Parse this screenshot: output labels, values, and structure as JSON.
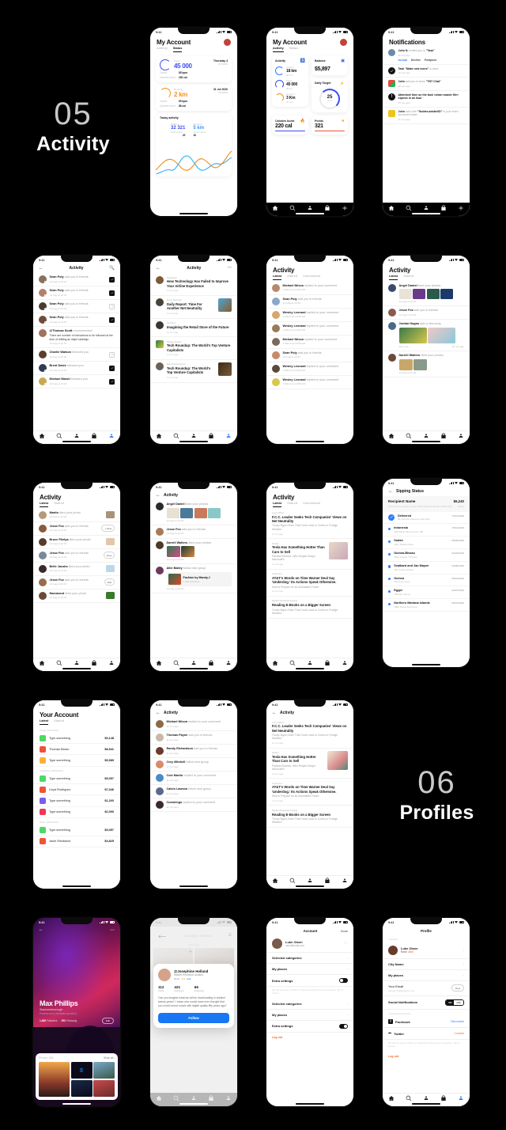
{
  "canvas": {
    "background": "#000000"
  },
  "sections": [
    {
      "number": "05",
      "title": "Activity"
    },
    {
      "number": "06",
      "title": "Profiles"
    }
  ],
  "status_bar": {
    "time": "9:41"
  },
  "colors": {
    "accent_blue": "#2f7bff",
    "indigo": "#3d4ef0",
    "orange": "#f59219",
    "logout_orange": "#f06a1e",
    "facebook_blue": "#1877f2",
    "green_dot": "#35c759"
  },
  "tabbar": {
    "items": [
      "home-icon",
      "search-icon",
      "people-icon",
      "bag-icon",
      "profile-icon"
    ]
  },
  "screens": {
    "my_account_status": {
      "title": "My Account",
      "tabs": [
        {
          "label": "Activity",
          "active": false
        },
        {
          "label": "Status",
          "active": true
        }
      ],
      "cards": [
        {
          "metric_label": "Steps",
          "metric_value": "45 000",
          "date": "Thursday 4",
          "time": "05:50PM",
          "rows": [
            {
              "k": "Cardio",
              "v": "85 bpm"
            },
            {
              "k": "Calories burnt",
              "v": "230 cal"
            }
          ]
        },
        {
          "metric_label": "Running",
          "metric_value": "2 km",
          "date": "31 Jul 2020",
          "time": "05:50PM",
          "rows": [
            {
              "k": "Cardio",
              "v": "65 bpm"
            },
            {
              "k": "Calories burnt",
              "v": "88 cal"
            }
          ]
        }
      ],
      "today": {
        "title": "Today activity",
        "left": {
          "label": "Walking",
          "value": "32 321",
          "sub": "1h30 active",
          "extra": "20"
        },
        "right": {
          "label": "Running",
          "value": "5 km",
          "sub": "30 min active",
          "extra": "16"
        }
      }
    },
    "my_account_activity": {
      "title": "My Account",
      "tabs": [
        {
          "label": "Activity",
          "active": true
        },
        {
          "label": "Status",
          "active": false
        }
      ],
      "activity_card_title": "Activity",
      "activities": [
        {
          "label": "Cycling",
          "value": "18 km",
          "sub": "68 min"
        },
        {
          "label": "Steps",
          "value": "45 000",
          "sub": "05 km"
        },
        {
          "label": "Running",
          "value": "3 Km",
          "sub": "32 min"
        }
      ],
      "balance": {
        "title": "Balance",
        "value": "$5,897"
      },
      "daily_target": {
        "title": "Daily Target",
        "value": "25",
        "unit": "of 40"
      },
      "calories": {
        "title": "Calories burnt",
        "value": "220 cal"
      },
      "points": {
        "title": "Points",
        "value": "321"
      }
    },
    "notifications": {
      "title": "Notifications",
      "items": [
        {
          "icon": "avatar",
          "bold": "John N.",
          "text": " invited you in ",
          "quoted": "\"Task\"",
          "time": "11 min ago",
          "actions": [
            "Accept",
            "Decline",
            "Postpone"
          ]
        },
        {
          "icon": "check",
          "bold": "Task ",
          "text": "",
          "quoted": "\"Make new icons\"",
          "suffix": " is done",
          "time": "10 min ago"
        },
        {
          "icon": "grid",
          "bold": "John",
          "text": " add you in team ",
          "quoted": "\"TNT Chat\"",
          "time": "08 min ago"
        },
        {
          "icon": "alert",
          "bold": "Attention!",
          "text": " time on the task «clean master file» expires in an hour",
          "time": "05 min ago"
        },
        {
          "icon": "file",
          "bold": "John",
          "text": " add a file ",
          "quoted": "\"Guides.adobeXD\"",
          "suffix": " in your team account's folder",
          "time": "11 min ago"
        }
      ]
    },
    "activity_friends": {
      "title": "Activity",
      "rows": [
        {
          "name": "Sean Poly",
          "action": " add you in friends",
          "time": "13 Aug at 10:12",
          "ctl": "check"
        },
        {
          "name": "Sean Poly",
          "action": " add you in friends",
          "time": "13 Aug at 12:33",
          "ctl": "check"
        },
        {
          "name": "Sean Poly",
          "action": " add you in friends",
          "time": "13 Aug at 12:33",
          "ctl": "plus"
        },
        {
          "name": "Sean Poly",
          "action": " add you in friends",
          "time": "13 Aug at 12:33",
          "ctl": "check"
        },
        {
          "name": "@Thomas Scott",
          "action": " recommended",
          "body": "There are number of instructions to be followed at the time of refilling an inkjet cartridge.",
          "time": "13 Aug at 12:33",
          "ctl": "none"
        },
        {
          "name": "Charlie Watson",
          "action": " followed you",
          "time": "13 Aug at 12:33",
          "ctl": "plus"
        },
        {
          "name": "Brent Davis",
          "action": " followed you",
          "time": "13 Aug at 12:33",
          "ctl": "check"
        },
        {
          "name": "Michael Marsh",
          "action": " followed you",
          "time": "13 Aug at 12:33",
          "ctl": "check"
        }
      ]
    },
    "news_list": {
      "title": "Activity",
      "items": [
        {
          "cat": "Firefighter",
          "title": "How Technology Has Failed to Improve Your Airline Experience",
          "time": "11 min ago",
          "img": false
        },
        {
          "cat": "Court Reporter",
          "title": "Daily Report: Time For Another Net Neutrality",
          "time": "11 min ago",
          "img": true
        },
        {
          "cat": "Architect",
          "title": "Imagining the Retail Store of the Future",
          "time": "11 min ago",
          "img": false
        },
        {
          "cat": "Mathematician",
          "title": "Tech Roundup: The World's Top Venture Capitalists",
          "time": "11 min ago",
          "img": false
        },
        {
          "cat": "Electrical Engineer",
          "title": "Tech Roundup: The World's Top Venture Capitalists",
          "time": "11 min ago",
          "img": true
        }
      ]
    },
    "activity_latest": {
      "title": "Activity",
      "tabs": [
        {
          "label": "Latest",
          "active": true
        },
        {
          "label": "Shared",
          "active": false
        },
        {
          "label": "Commented",
          "active": false
        }
      ],
      "rows": [
        {
          "name": "Michael Nilson",
          "action": " replied to your comment",
          "time": "4 March at 10:55 AM"
        },
        {
          "name": "Sean Poly",
          "action": " add you in friends",
          "time": "13 August 12:33"
        },
        {
          "name": "Wesley Leonard",
          "action": " replied to your comment",
          "time": "4 March at 10:55 AM"
        },
        {
          "name": "Wesley Leonard",
          "action": " replied to your comment",
          "time": "4 March at 10:55 AM"
        },
        {
          "name": "Michael Nilson",
          "action": " replied to your comment",
          "time": "4 March at 10:55 AM"
        },
        {
          "name": "Sean Poly",
          "action": " add you in friends",
          "time": "13 August 12:33"
        },
        {
          "name": "Wesley Leonard",
          "action": " replied to your comment",
          "time": "4 March at 10:55 AM"
        },
        {
          "name": "Wesley Leonard",
          "action": " replied to your comment",
          "time": "4 March at 10:55 AM"
        }
      ]
    },
    "activity_photos": {
      "title": "Activity",
      "tabs": [
        {
          "label": "Latest",
          "active": true
        },
        {
          "label": "Shared",
          "active": false
        }
      ],
      "rows": [
        {
          "name": "Angel Daniel",
          "action": " liked your photos",
          "time": "13 Aug at 12:33",
          "photos": 4
        },
        {
          "name": "Jesse Fox",
          "action": " add you in friends",
          "time": "13 Aug at 12:33",
          "photos": 0
        },
        {
          "name": "Jordan Hogan",
          "action": " add a new story",
          "photos": 2,
          "caption_left": "Just now",
          "caption_right": "45 min ago"
        },
        {
          "name": "Darrell Walters",
          "action": " liked your photos",
          "time": "13 Aug at 12:33",
          "photos": 2
        }
      ]
    },
    "activity_actions": {
      "title": "Activity",
      "tabs": [
        {
          "label": "Latest",
          "active": true
        },
        {
          "label": "Shared",
          "active": false
        }
      ],
      "rows": [
        {
          "name": "Martin",
          "action": " liked your photo",
          "time": "13 Aug at 12:33",
          "ctl": "thumb"
        },
        {
          "name": "Jesse Fox",
          "action": " add you in friends",
          "time": "13 Aug at 12:33",
          "ctl": "btn",
          "btn": "+ Now"
        },
        {
          "name": "Bruce Phelps",
          "action": " liked your photo",
          "time": "13 Aug at 12:33",
          "ctl": "thumb"
        },
        {
          "name": "Jesse Fox",
          "action": " add you in friends",
          "time": "13 Aug at 12:33",
          "ctl": "btn",
          "btn": "View"
        },
        {
          "name": "Belle Jacobs",
          "action": " liked your photo",
          "time": "13 Aug at 12:33",
          "ctl": "thumb"
        },
        {
          "name": "Jesse Fox",
          "action": " add you in friends",
          "time": "13 Aug at 12:33",
          "ctl": "btn",
          "btn": "Add"
        },
        {
          "name": "Hammond",
          "action": " liked your photo",
          "time": "13 Aug at 12:33",
          "ctl": "thumb"
        }
      ]
    },
    "activity_groups": {
      "title": "Activity",
      "rows": [
        {
          "name": "Angel Daniel",
          "action": " liked your photos",
          "time": "13 Aug at 12:33",
          "photos": 4
        },
        {
          "name": "Jesse Fox",
          "action": " add you in friends",
          "time": "13 Aug at 12:33",
          "photos": 0
        },
        {
          "name": "Darrell Walters",
          "action": " liked your photos",
          "time": "13 Aug at 12:33",
          "photos": 2
        },
        {
          "name": "Allie Bailey",
          "action": " follow new group",
          "time": "13 Aug at 12:33",
          "group": {
            "title": "Fashion",
            "by": "by Mandy.J",
            "members": "1,165 followers"
          }
        }
      ]
    },
    "activity_simple": {
      "title": "Activity",
      "rows": [
        {
          "name": "Michael Nilson",
          "action": " replied to your comment",
          "time": "11 min ago"
        },
        {
          "name": "Thomas Payne",
          "action": " add you in friends",
          "time": "11 min ago"
        },
        {
          "name": "Randy Richardson",
          "action": " add you in friends",
          "time": "11 min ago"
        },
        {
          "name": "Cory Mitchell",
          "action": " follow new group",
          "time": "11 min ago"
        },
        {
          "name": "Cole Martin",
          "action": " replied to your comment",
          "time": "11 min ago"
        },
        {
          "name": "Calvin Lawson",
          "action": " follow new group",
          "time": "11 min ago"
        },
        {
          "name": "Cummings",
          "action": " replied to your comment",
          "time": "11 min ago"
        }
      ]
    },
    "news_detail": {
      "title": "Activity",
      "items": [
        {
          "cat": "Loan Officer",
          "title": "F.C.C. Leader Seeks Tech Companies' Views on Net Neutrality",
          "sub": "Trump Signs Order That Could Lead to Curbs on Foreign Workers",
          "time": "11 min ago",
          "img": false
        },
        {
          "cat": "Drafter",
          "title": "Tesla Has Something Hotter Than Cars to Sell",
          "sub": "Pamela Edstrom, Who Helped Shape Microsoft's",
          "time": "11 min ago",
          "img": true
        },
        {
          "cat": "Carpenter",
          "title": "AT&T's Words on Time Warner Deal Say 'Underdog.' Its Actions Speak Otherwise.",
          "sub": "How to Prepare for an Automated Future",
          "time": "11 min ago",
          "img": false
        },
        {
          "cat": "Market Research Analyst",
          "title": "Reading E-Books on a Bigger Screen",
          "sub": "Trump Signs Order That Could Lead to Curbs on Foreign Workers",
          "time": "",
          "img": false
        }
      ]
    },
    "shipping": {
      "title": "Sipping Status",
      "recipient_label": "Recipient Name",
      "price": "$6,240",
      "address": "4720 Jenna Junction Suite 789 Falkland Islands (Malvinas)",
      "address_right": "Office",
      "rows": [
        {
          "name": "Delivered",
          "addr": "65 Katrude Gardens Suite 682",
          "date": "07/11/2019",
          "done": true
        },
        {
          "name": "Indonesia",
          "addr": "449 Mattie Skyway Apt. 786",
          "date": "07/11/2019",
          "done": false
        },
        {
          "name": "Sudan",
          "addr": "1397 Sasika Place",
          "date": "08/03/2019",
          "done": false
        },
        {
          "name": "Guinea-Bissau",
          "addr": "1592 Unique Turnpike",
          "date": "04/24/2019",
          "done": false
        },
        {
          "name": "Svalbard and Jan Mayen",
          "addr": "205 Isobel Heights",
          "date": "04/06/2019",
          "done": false
        },
        {
          "name": "Guinea",
          "addr": "904 Doss Loop",
          "date": "06/16/2019",
          "done": false
        },
        {
          "name": "Egypt",
          "addr": "789 Zinu Manor",
          "date": "02/07/2019",
          "done": false
        },
        {
          "name": "Northern Mariana Islands",
          "addr": "1689 Pacult Extension",
          "date": "05/07/2019",
          "done": false
        }
      ]
    },
    "your_account": {
      "title": "Your Account",
      "tabs": [
        {
          "label": "Latest",
          "active": true
        },
        {
          "label": "Shared",
          "active": false
        }
      ],
      "groups": [
        {
          "header": "Today, 08/11/2019",
          "rows": [
            {
              "name": "Type something",
              "amount": "$9,148",
              "color": "#4cd964"
            },
            {
              "name": "Thomas Moran",
              "amount": "$8,941",
              "color": "#f0523a"
            },
            {
              "name": "Type something",
              "amount": "$5,989",
              "color": "#ffb03a"
            }
          ]
        },
        {
          "header": "Yesterday, 08/10/2019",
          "rows": [
            {
              "name": "Type something",
              "amount": "$5,057",
              "color": "#4cd964"
            },
            {
              "name": "Lloyd Rodriguez",
              "amount": "$7,046",
              "color": "#f0523a"
            },
            {
              "name": "Type something",
              "amount": "$1,260",
              "color": "#7a5cf0"
            },
            {
              "name": "Type something",
              "amount": "$2,090",
              "color": "#f0355a"
            }
          ]
        },
        {
          "header": "Older, 08/01/2019",
          "rows": [
            {
              "name": "Type something",
              "amount": "$5,057",
              "color": "#4cd964"
            },
            {
              "name": "Janie Strickland",
              "amount": "$4,825",
              "color": "#f0523a"
            }
          ]
        }
      ]
    },
    "profile_hero": {
      "name": "Max Phillips",
      "subtitle": "Stephanieborough",
      "link": "Pamela.com [ wildmana.puzzles ]",
      "followers_count": "1,368",
      "followers_label": "Followers",
      "following_count": "253",
      "following_label": "Following",
      "edit_label": "Edit",
      "photos_label": "Photos",
      "photos_count": "168",
      "show_all": "Show all"
    },
    "catalog_modal": {
      "title": "Catalog",
      "subtitle": "/ Fashion",
      "count": "1 453 items",
      "cells": [
        {
          "label": "Sofia Jones"
        },
        {
          "label": "Fiery Jackson"
        }
      ],
      "profile": {
        "handle": "@Josephine Holland",
        "role": "Market Research Analyst",
        "rank_label": "Rank:",
        "rank_value": "1.0",
        "stats": [
          {
            "value": "112",
            "label": "Posts"
          },
          {
            "value": "421",
            "label": "Followers"
          },
          {
            "value": "66",
            "label": "Following"
          }
        ],
        "bio": "Can you imagine what we will be downloading in another twenty years? I mean who would have ever thought that you could record sound with digital quality fifty years ago?",
        "follow_label": "Follow"
      }
    },
    "account_settings": {
      "title": "Account",
      "done_label": "Done",
      "user": {
        "name": "Luke Olsen",
        "email": "user@email.com"
      },
      "group1": [
        {
          "label": "Selected categories",
          "type": "chevron"
        },
        {
          "label": "My places",
          "type": "chevron"
        },
        {
          "label": "Extra settings",
          "type": "toggle",
          "on": false
        }
      ],
      "hint": "We will not post to Twitter or Facebook without your permission. Tap to cancel",
      "group2": [
        {
          "label": "Selected categories",
          "type": "chevron"
        },
        {
          "label": "My places",
          "type": "chevron"
        },
        {
          "label": "Extra settings",
          "type": "toggle",
          "on": true
        }
      ],
      "logout": "Log out"
    },
    "profile_settings": {
      "title": "Profile",
      "section_account": "Account",
      "user": {
        "name": "Luke Olsen",
        "rank_label": "Rank:",
        "rank_value": "10.0"
      },
      "rows": [
        {
          "label": "City Name",
          "type": "chevron"
        },
        {
          "label": "My places",
          "type": "chevron"
        }
      ],
      "email_row": {
        "label": "Your Email",
        "value": "danger.mail@dejure.net",
        "button": "View"
      },
      "social_row": {
        "label": "Social Notifications",
        "on": "ON",
        "off": "OFF"
      },
      "section_connected": "Connected accounts",
      "connected": [
        {
          "label": "Facebook",
          "action": "Disconnect",
          "action_color": "#2f7bff",
          "icon": "facebook-icon"
        },
        {
          "label": "Twitter",
          "action": "Connect",
          "action_color": "#f06a1e",
          "icon": "twitter-icon"
        }
      ],
      "hint": "We will not post to Twitter or Facebook without your permission. Tap to cancel",
      "logout": "Log out"
    }
  }
}
